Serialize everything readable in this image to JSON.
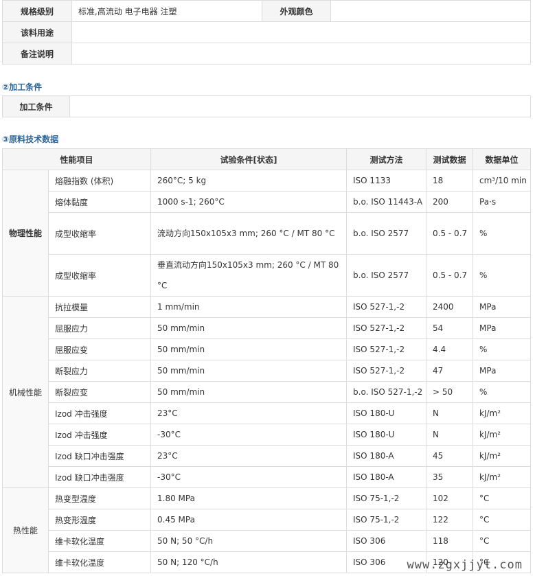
{
  "info": {
    "grade_label": "规格级别",
    "grade_value": "标准,高流动 电子电器 注塑",
    "color_label": "外观颜色",
    "color_value": "",
    "usage_label": "该料用途",
    "usage_value": "",
    "remark_label": "备注说明",
    "remark_value": ""
  },
  "processing": {
    "section_title": "②加工条件",
    "label": "加工条件",
    "value": ""
  },
  "tech": {
    "section_title": "③原料技术数据",
    "headers": [
      "性能项目",
      "试验条件[状态]",
      "测试方法",
      "测试数据",
      "数据单位"
    ],
    "groups": {
      "physical": "物理性能",
      "mechanical": "机械性能",
      "thermal": "热性能"
    },
    "rows": [
      {
        "item": "熔融指数 (体积)",
        "cond": "260°C; 5 kg",
        "method": "ISO 1133",
        "value": "18",
        "unit": "cm³/10 min"
      },
      {
        "item": "熔体黏度",
        "cond": "1000 s-1; 260°C",
        "method": "b.o. ISO 11443-A",
        "value": "200",
        "unit": "Pa·s"
      },
      {
        "item": "成型收缩率",
        "cond": "流动方向150x105x3 mm; 260 °C / MT 80 °C",
        "method": "b.o. ISO 2577",
        "value": "0.5 - 0.7",
        "unit": "%"
      },
      {
        "item": "成型收缩率",
        "cond": "垂直流动方向150x105x3 mm; 260 °C / MT 80 °C",
        "method": "b.o. ISO 2577",
        "value": "0.5 - 0.7",
        "unit": "%"
      },
      {
        "item": "抗拉模量",
        "cond": "1 mm/min",
        "method": "ISO 527-1,-2",
        "value": "2400",
        "unit": "MPa"
      },
      {
        "item": "屈服应力",
        "cond": "50 mm/min",
        "method": "ISO 527-1,-2",
        "value": "54",
        "unit": "MPa"
      },
      {
        "item": "屈服应变",
        "cond": "50 mm/min",
        "method": "ISO 527-1,-2",
        "value": "4.4",
        "unit": "%"
      },
      {
        "item": "断裂应力",
        "cond": "50 mm/min",
        "method": "ISO 527-1,-2",
        "value": "47",
        "unit": "MPa"
      },
      {
        "item": "断裂应变",
        "cond": "50 mm/min",
        "method": "b.o. ISO 527-1,-2",
        "value": "> 50",
        "unit": "%"
      },
      {
        "item": "Izod 冲击强度",
        "cond": "23°C",
        "method": "ISO 180-U",
        "value": "N",
        "unit": "kJ/m²"
      },
      {
        "item": "Izod 冲击强度",
        "cond": "-30°C",
        "method": "ISO 180-U",
        "value": "N",
        "unit": "kJ/m²"
      },
      {
        "item": "Izod 缺口冲击强度",
        "cond": "23°C",
        "method": "ISO 180-A",
        "value": "45",
        "unit": "kJ/m²"
      },
      {
        "item": "Izod 缺口冲击强度",
        "cond": "-30°C",
        "method": "ISO 180-A",
        "value": "35",
        "unit": "kJ/m²"
      },
      {
        "item": "热变型温度",
        "cond": "1.80 MPa",
        "method": "ISO 75-1,-2",
        "value": "102",
        "unit": "°C"
      },
      {
        "item": "热变形温度",
        "cond": "0.45 MPa",
        "method": "ISO 75-1,-2",
        "value": "122",
        "unit": "°C"
      },
      {
        "item": "维卡软化温度",
        "cond": "50 N; 50 °C/h",
        "method": "ISO 306",
        "value": "118",
        "unit": "°C"
      },
      {
        "item": "维卡软化温度",
        "cond": "50 N; 120 °C/h",
        "method": "ISO 306",
        "value": "120",
        "unit": "°C"
      }
    ]
  },
  "watermark": "www.zgxjjyt.com"
}
